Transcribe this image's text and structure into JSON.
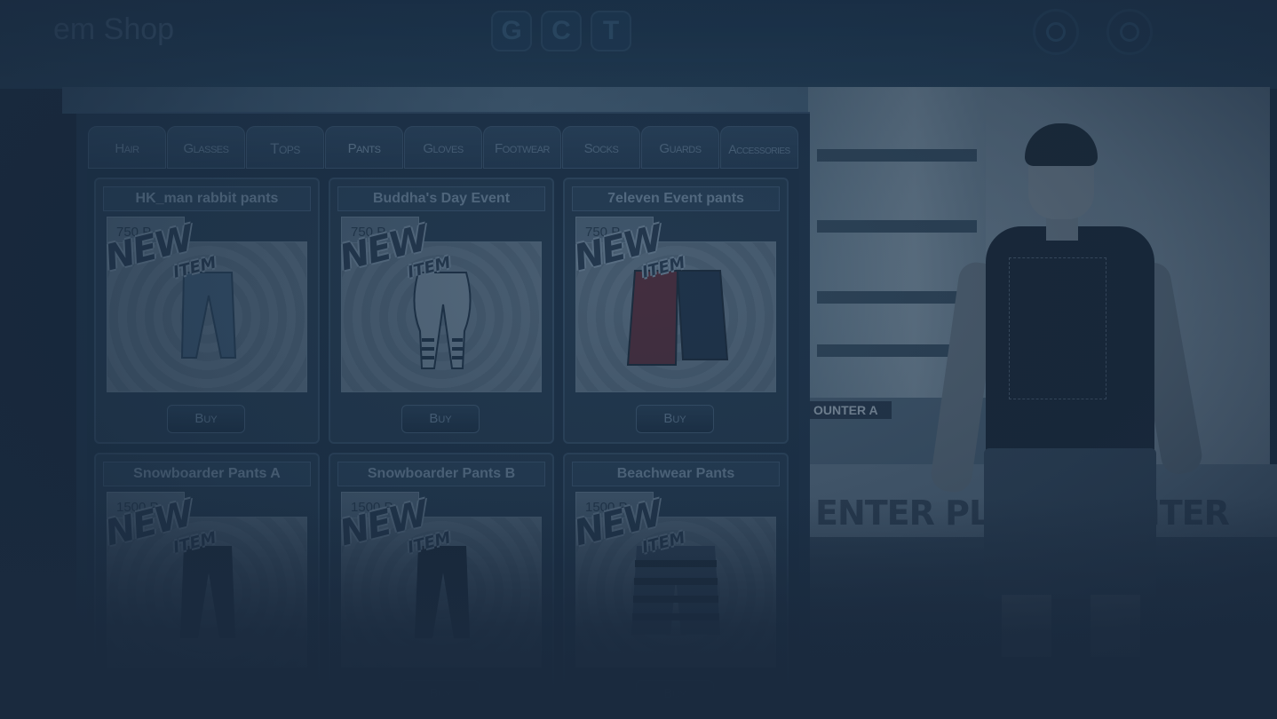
{
  "header": {
    "title": "em Shop",
    "mode_buttons": [
      "G",
      "C",
      "T"
    ]
  },
  "tabs": [
    "Hair",
    "Glasses",
    "Tops",
    "Pants",
    "Gloves",
    "Footwear",
    "Socks",
    "Guards",
    "Accessories"
  ],
  "active_tab": "Pants",
  "items": [
    {
      "name": "HK_man rabbit pants",
      "price": "750 P",
      "badge_main": "NEW",
      "badge_sub": "ITEM",
      "buy_label": "Buy"
    },
    {
      "name": "Buddha's Day Event",
      "price": "750 P",
      "badge_main": "NEW",
      "badge_sub": "ITEM",
      "buy_label": "Buy"
    },
    {
      "name": "7eleven Event pants",
      "price": "750 P",
      "badge_main": "NEW",
      "badge_sub": "ITEM",
      "buy_label": "Buy"
    },
    {
      "name": "Snowboarder Pants A",
      "price": "1500 P",
      "badge_main": "NEW",
      "badge_sub": "ITEM",
      "buy_label": "Buy"
    },
    {
      "name": "Snowboarder Pants B",
      "price": "1500 P",
      "badge_main": "NEW",
      "badge_sub": "ITEM",
      "buy_label": "Buy"
    },
    {
      "name": "Beachwear Pants",
      "price": "1500 P",
      "badge_main": "NEW",
      "badge_sub": "ITEM",
      "buy_label": "Buy"
    }
  ],
  "scene": {
    "store_sign": "OUNTER A",
    "wall_text_1": "ENTER PLAY",
    "wall_text_2": "ENTER PLAY"
  },
  "colors": {
    "overlay": "#1a2a3e",
    "panel": "#243a52",
    "accent_text": "#7e98b0"
  }
}
